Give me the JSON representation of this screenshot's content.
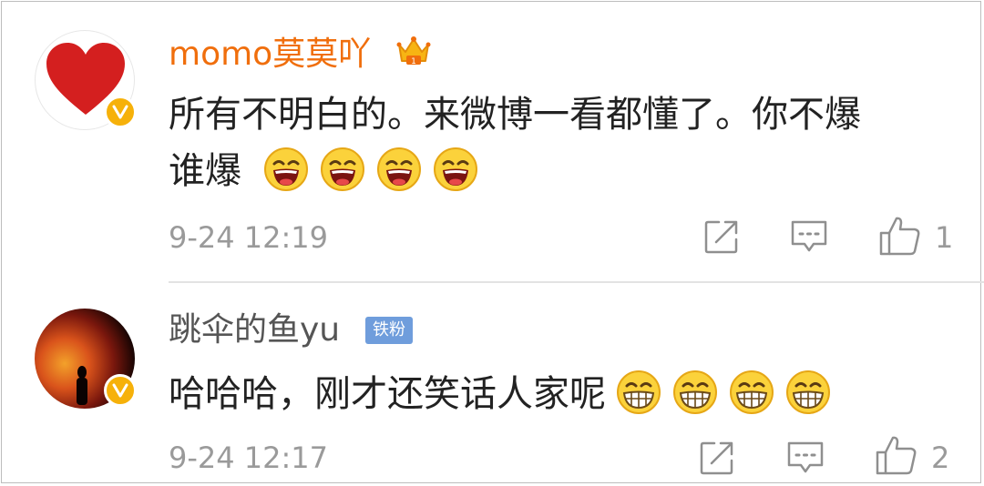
{
  "comments": [
    {
      "username": "momo莫莫吖",
      "username_color": "#f06e0c",
      "avatar": "red-heart-avatar",
      "verified_badge": "v-icon",
      "member_icon": "crown-icon",
      "text_line1": "所有不明白的。来微博一看都懂了。你不爆",
      "text_line2": "谁爆",
      "emoji": "laughing-emoji",
      "emoji_count": 4,
      "time": "9-24 12:19",
      "like_count": "1"
    },
    {
      "username": "跳伞的鱼yu",
      "username_color": "#555555",
      "avatar": "fire-avatar",
      "verified_badge": "v-icon",
      "fan_badge": "铁粉",
      "text_line1": "哈哈哈，刚才还笑话人家呢",
      "emoji": "grinning-emoji",
      "emoji_count": 4,
      "time": "9-24 12:17",
      "like_count": "2"
    }
  ],
  "actions": [
    "share-icon",
    "reply-icon",
    "like-icon"
  ]
}
